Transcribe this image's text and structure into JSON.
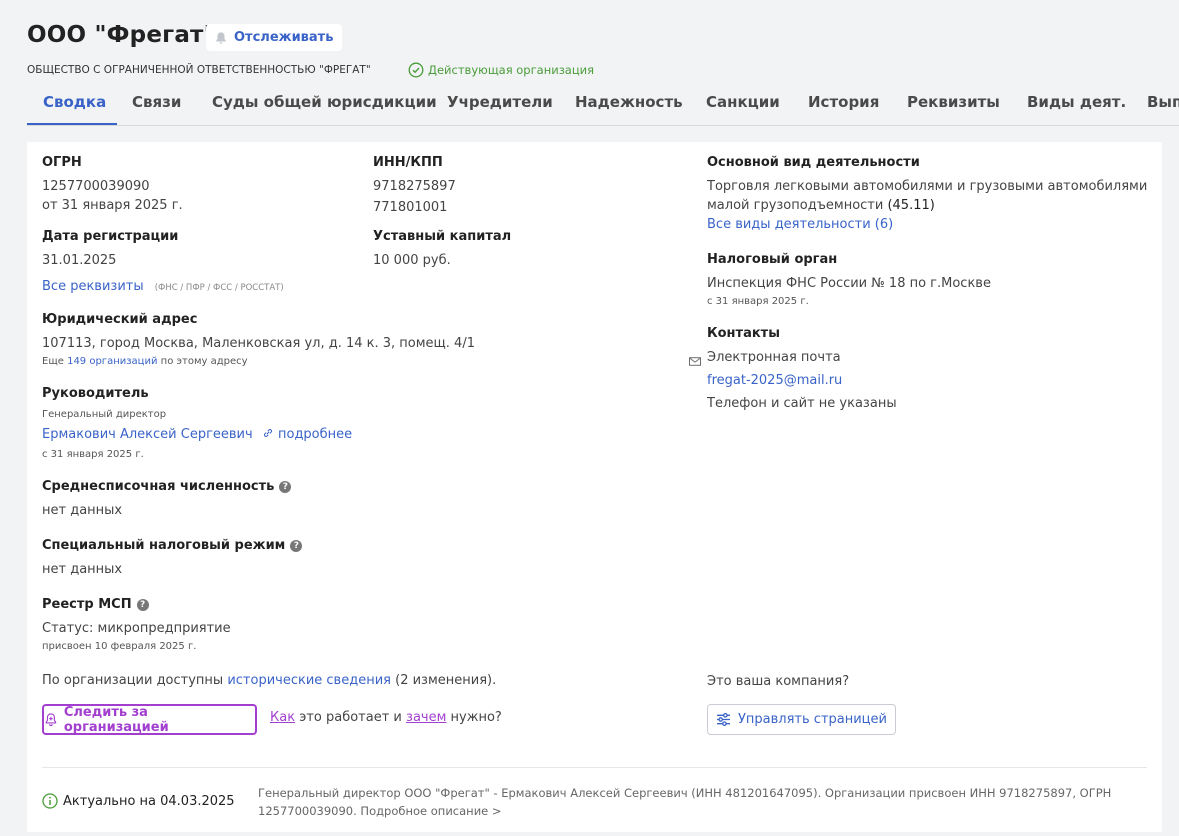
{
  "header": {
    "title": "ООО \"Фрегат\"",
    "follow_label": "Отслеживать",
    "full_name": "ОБЩЕСТВО С ОГРАНИЧЕННОЙ ОТВЕТСТВЕННОСТЬЮ \"ФРЕГАТ\"",
    "status": "Действующая организация",
    "status_color": "#4a9c3a"
  },
  "tabs": [
    "Сводка",
    "Связи",
    "Суды общей юрисдикции",
    "Учредители",
    "Надежность",
    "Санкции",
    "История",
    "Реквизиты",
    "Виды деят.",
    "Вып"
  ],
  "active_tab": "Сводка",
  "ogrn": {
    "label": "ОГРН",
    "value": "1257700039090",
    "date": "от 31 января 2025 г."
  },
  "inn": {
    "label": "ИНН/КПП",
    "inn": "9718275897",
    "kpp": "771801001"
  },
  "reg_date": {
    "label": "Дата регистрации",
    "value": "31.01.2025",
    "all_link": "Все реквизиты",
    "sources": "(ФНС / ПФР / ФСС / РОССТАТ)"
  },
  "capital": {
    "label": "Уставный капитал",
    "value": "10 000 руб."
  },
  "address": {
    "label": "Юридический адрес",
    "value": "107113, город Москва, Маленковская ул, д. 14 к. 3, помещ. 4/1",
    "more_prefix": "Еще",
    "more_link": "149 организаций",
    "more_suffix": "по этому адресу"
  },
  "director": {
    "label": "Руководитель",
    "position": "Генеральный директор",
    "name": "Ермакович Алексей Сергеевич",
    "details_link": "подробнее",
    "since": "с 31 января 2025 г."
  },
  "headcount": {
    "label": "Среднесписочная численность",
    "value": "нет данных"
  },
  "tax_regime": {
    "label": "Специальный налоговый режим",
    "value": "нет данных"
  },
  "msp": {
    "label": "Реестр МСП",
    "status": "Статус: микропредприятие",
    "assigned": "присвоен 10 февраля 2025 г."
  },
  "activity": {
    "label": "Основной вид деятельности",
    "line1": "Торговля легковыми автомобилями и грузовыми автомобилями",
    "line2": "малой грузоподъемности",
    "code": "(45.11)",
    "all_link": "Все виды деятельности (6)"
  },
  "tax_office": {
    "label": "Налоговый орган",
    "value": "Инспекция ФНС России № 18 по г.Москве",
    "since": "с 31 января 2025 г."
  },
  "contacts": {
    "label": "Контакты",
    "email_label": "Электронная почта",
    "email": "fregat-2025@mail.ru",
    "phone_note": "Телефон и сайт не указаны"
  },
  "history": {
    "prefix": "По организации доступны",
    "link": "исторические сведения",
    "suffix": "(2 изменения)."
  },
  "watch": {
    "button": "Следить за организацией",
    "how": "Как",
    "mid": "это работает и",
    "why": "зачем",
    "end": "нужно?"
  },
  "manage": {
    "question": "Это ваша компания?",
    "button": "Управлять страницей"
  },
  "footer": {
    "actual": "Актуально на 04.03.2025",
    "description": "Генеральный директор ООО \"Фрегат\" - Ермакович Алексей Сергеевич (ИНН 481201647095). Организации присвоен ИНН 9718275897, ОГРН 1257700039090. Подробное описание >"
  },
  "colors": {
    "accent": "#3a63c8",
    "purple": "#a23fcf",
    "green": "#4a9c3a"
  }
}
